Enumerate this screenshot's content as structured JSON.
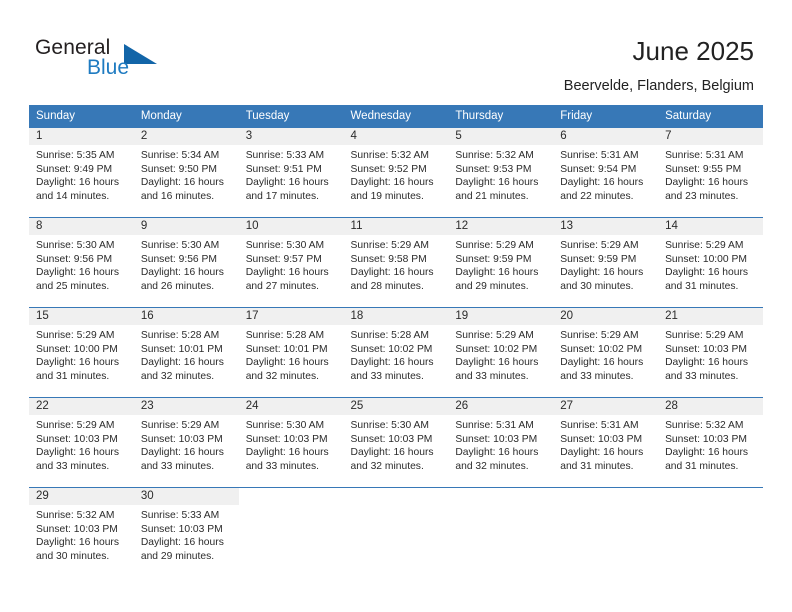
{
  "brand": {
    "name_part1": "General",
    "name_part2": "Blue",
    "triangle_icon": "triangle-logo-icon",
    "accent_color": "#1265a8"
  },
  "header": {
    "title": "June 2025",
    "location": "Beervelde, Flanders, Belgium"
  },
  "calendar": {
    "header_color": "#3778b7",
    "daynum_band_color": "#f0f0f0",
    "weekday_headers": [
      "Sunday",
      "Monday",
      "Tuesday",
      "Wednesday",
      "Thursday",
      "Friday",
      "Saturday"
    ],
    "weeks": [
      [
        {
          "day": "1",
          "sunrise": "Sunrise: 5:35 AM",
          "sunset": "Sunset: 9:49 PM",
          "daylight_line1": "Daylight: 16 hours",
          "daylight_line2": "and 14 minutes."
        },
        {
          "day": "2",
          "sunrise": "Sunrise: 5:34 AM",
          "sunset": "Sunset: 9:50 PM",
          "daylight_line1": "Daylight: 16 hours",
          "daylight_line2": "and 16 minutes."
        },
        {
          "day": "3",
          "sunrise": "Sunrise: 5:33 AM",
          "sunset": "Sunset: 9:51 PM",
          "daylight_line1": "Daylight: 16 hours",
          "daylight_line2": "and 17 minutes."
        },
        {
          "day": "4",
          "sunrise": "Sunrise: 5:32 AM",
          "sunset": "Sunset: 9:52 PM",
          "daylight_line1": "Daylight: 16 hours",
          "daylight_line2": "and 19 minutes."
        },
        {
          "day": "5",
          "sunrise": "Sunrise: 5:32 AM",
          "sunset": "Sunset: 9:53 PM",
          "daylight_line1": "Daylight: 16 hours",
          "daylight_line2": "and 21 minutes."
        },
        {
          "day": "6",
          "sunrise": "Sunrise: 5:31 AM",
          "sunset": "Sunset: 9:54 PM",
          "daylight_line1": "Daylight: 16 hours",
          "daylight_line2": "and 22 minutes."
        },
        {
          "day": "7",
          "sunrise": "Sunrise: 5:31 AM",
          "sunset": "Sunset: 9:55 PM",
          "daylight_line1": "Daylight: 16 hours",
          "daylight_line2": "and 23 minutes."
        }
      ],
      [
        {
          "day": "8",
          "sunrise": "Sunrise: 5:30 AM",
          "sunset": "Sunset: 9:56 PM",
          "daylight_line1": "Daylight: 16 hours",
          "daylight_line2": "and 25 minutes."
        },
        {
          "day": "9",
          "sunrise": "Sunrise: 5:30 AM",
          "sunset": "Sunset: 9:56 PM",
          "daylight_line1": "Daylight: 16 hours",
          "daylight_line2": "and 26 minutes."
        },
        {
          "day": "10",
          "sunrise": "Sunrise: 5:30 AM",
          "sunset": "Sunset: 9:57 PM",
          "daylight_line1": "Daylight: 16 hours",
          "daylight_line2": "and 27 minutes."
        },
        {
          "day": "11",
          "sunrise": "Sunrise: 5:29 AM",
          "sunset": "Sunset: 9:58 PM",
          "daylight_line1": "Daylight: 16 hours",
          "daylight_line2": "and 28 minutes."
        },
        {
          "day": "12",
          "sunrise": "Sunrise: 5:29 AM",
          "sunset": "Sunset: 9:59 PM",
          "daylight_line1": "Daylight: 16 hours",
          "daylight_line2": "and 29 minutes."
        },
        {
          "day": "13",
          "sunrise": "Sunrise: 5:29 AM",
          "sunset": "Sunset: 9:59 PM",
          "daylight_line1": "Daylight: 16 hours",
          "daylight_line2": "and 30 minutes."
        },
        {
          "day": "14",
          "sunrise": "Sunrise: 5:29 AM",
          "sunset": "Sunset: 10:00 PM",
          "daylight_line1": "Daylight: 16 hours",
          "daylight_line2": "and 31 minutes."
        }
      ],
      [
        {
          "day": "15",
          "sunrise": "Sunrise: 5:29 AM",
          "sunset": "Sunset: 10:00 PM",
          "daylight_line1": "Daylight: 16 hours",
          "daylight_line2": "and 31 minutes."
        },
        {
          "day": "16",
          "sunrise": "Sunrise: 5:28 AM",
          "sunset": "Sunset: 10:01 PM",
          "daylight_line1": "Daylight: 16 hours",
          "daylight_line2": "and 32 minutes."
        },
        {
          "day": "17",
          "sunrise": "Sunrise: 5:28 AM",
          "sunset": "Sunset: 10:01 PM",
          "daylight_line1": "Daylight: 16 hours",
          "daylight_line2": "and 32 minutes."
        },
        {
          "day": "18",
          "sunrise": "Sunrise: 5:28 AM",
          "sunset": "Sunset: 10:02 PM",
          "daylight_line1": "Daylight: 16 hours",
          "daylight_line2": "and 33 minutes."
        },
        {
          "day": "19",
          "sunrise": "Sunrise: 5:29 AM",
          "sunset": "Sunset: 10:02 PM",
          "daylight_line1": "Daylight: 16 hours",
          "daylight_line2": "and 33 minutes."
        },
        {
          "day": "20",
          "sunrise": "Sunrise: 5:29 AM",
          "sunset": "Sunset: 10:02 PM",
          "daylight_line1": "Daylight: 16 hours",
          "daylight_line2": "and 33 minutes."
        },
        {
          "day": "21",
          "sunrise": "Sunrise: 5:29 AM",
          "sunset": "Sunset: 10:03 PM",
          "daylight_line1": "Daylight: 16 hours",
          "daylight_line2": "and 33 minutes."
        }
      ],
      [
        {
          "day": "22",
          "sunrise": "Sunrise: 5:29 AM",
          "sunset": "Sunset: 10:03 PM",
          "daylight_line1": "Daylight: 16 hours",
          "daylight_line2": "and 33 minutes."
        },
        {
          "day": "23",
          "sunrise": "Sunrise: 5:29 AM",
          "sunset": "Sunset: 10:03 PM",
          "daylight_line1": "Daylight: 16 hours",
          "daylight_line2": "and 33 minutes."
        },
        {
          "day": "24",
          "sunrise": "Sunrise: 5:30 AM",
          "sunset": "Sunset: 10:03 PM",
          "daylight_line1": "Daylight: 16 hours",
          "daylight_line2": "and 33 minutes."
        },
        {
          "day": "25",
          "sunrise": "Sunrise: 5:30 AM",
          "sunset": "Sunset: 10:03 PM",
          "daylight_line1": "Daylight: 16 hours",
          "daylight_line2": "and 32 minutes."
        },
        {
          "day": "26",
          "sunrise": "Sunrise: 5:31 AM",
          "sunset": "Sunset: 10:03 PM",
          "daylight_line1": "Daylight: 16 hours",
          "daylight_line2": "and 32 minutes."
        },
        {
          "day": "27",
          "sunrise": "Sunrise: 5:31 AM",
          "sunset": "Sunset: 10:03 PM",
          "daylight_line1": "Daylight: 16 hours",
          "daylight_line2": "and 31 minutes."
        },
        {
          "day": "28",
          "sunrise": "Sunrise: 5:32 AM",
          "sunset": "Sunset: 10:03 PM",
          "daylight_line1": "Daylight: 16 hours",
          "daylight_line2": "and 31 minutes."
        }
      ],
      [
        {
          "day": "29",
          "sunrise": "Sunrise: 5:32 AM",
          "sunset": "Sunset: 10:03 PM",
          "daylight_line1": "Daylight: 16 hours",
          "daylight_line2": "and 30 minutes."
        },
        {
          "day": "30",
          "sunrise": "Sunrise: 5:33 AM",
          "sunset": "Sunset: 10:03 PM",
          "daylight_line1": "Daylight: 16 hours",
          "daylight_line2": "and 29 minutes."
        },
        {
          "day": "",
          "sunrise": "",
          "sunset": "",
          "daylight_line1": "",
          "daylight_line2": ""
        },
        {
          "day": "",
          "sunrise": "",
          "sunset": "",
          "daylight_line1": "",
          "daylight_line2": ""
        },
        {
          "day": "",
          "sunrise": "",
          "sunset": "",
          "daylight_line1": "",
          "daylight_line2": ""
        },
        {
          "day": "",
          "sunrise": "",
          "sunset": "",
          "daylight_line1": "",
          "daylight_line2": ""
        },
        {
          "day": "",
          "sunrise": "",
          "sunset": "",
          "daylight_line1": "",
          "daylight_line2": ""
        }
      ]
    ]
  }
}
